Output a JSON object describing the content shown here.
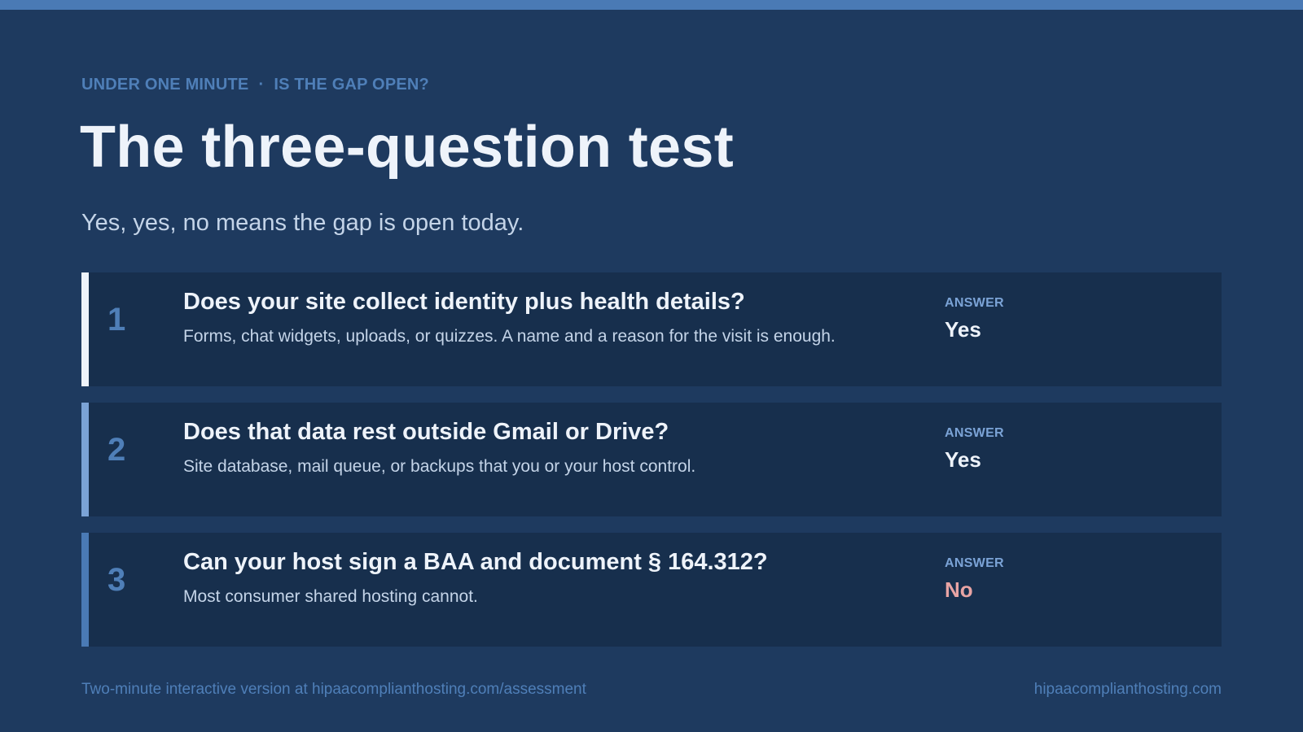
{
  "kicker": {
    "left": "UNDER ONE MINUTE",
    "separator": "·",
    "right": "IS THE GAP OPEN?"
  },
  "title": "The three-question test",
  "subtitle": "Yes, yes, no means the gap is open today.",
  "questions": [
    {
      "number": "1",
      "question": "Does your site collect identity plus health details?",
      "detail": "Forms, chat widgets, uploads, or quizzes. A name and a reason for the visit is enough.",
      "answer_label": "ANSWER",
      "answer": "Yes"
    },
    {
      "number": "2",
      "question": "Does that data rest outside Gmail or Drive?",
      "detail": "Site database, mail queue, or backups that you or your host control.",
      "answer_label": "ANSWER",
      "answer": "Yes"
    },
    {
      "number": "3",
      "question": "Can your host sign a BAA and document § 164.312?",
      "detail": "Most consumer shared hosting cannot.",
      "answer_label": "ANSWER",
      "answer": "No"
    }
  ],
  "footer": {
    "left": "Two-minute interactive version at hipaacomplianthosting.com/assessment",
    "right": "hipaacomplianthosting.com"
  },
  "colors": {
    "background": "#1e3a5f",
    "card": "#172f4d",
    "accent": "#4a7ab5",
    "yes": "#eef3fa",
    "no": "#e8a4a4"
  }
}
